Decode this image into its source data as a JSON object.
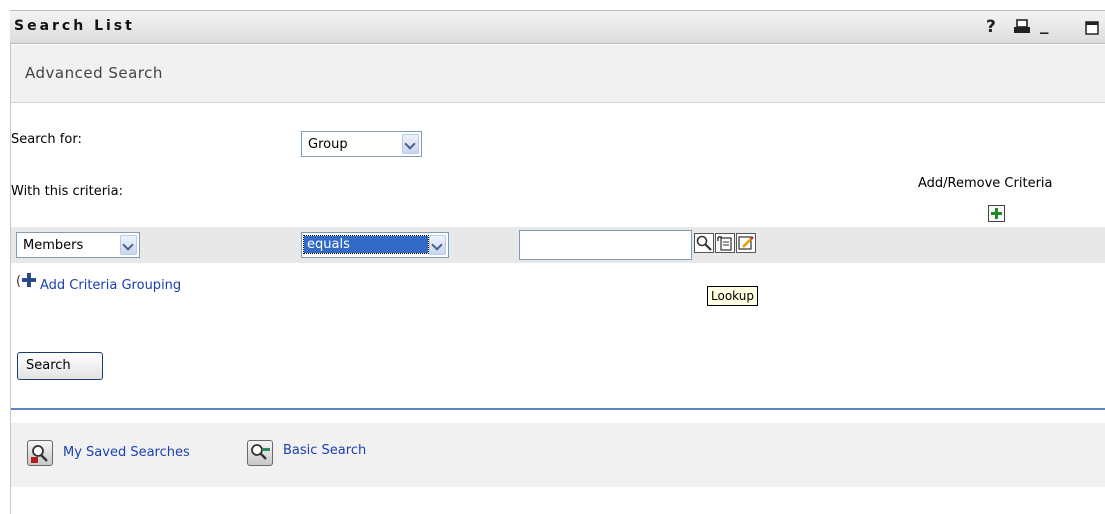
{
  "window": {
    "title": "Search List",
    "controls": {
      "help": "?",
      "print_icon": "print-icon",
      "minimize": "_",
      "maximize_icon": "maximize-icon"
    }
  },
  "header": {
    "subtitle": "Advanced Search"
  },
  "form": {
    "search_for_label": "Search for:",
    "search_for_value": "Group",
    "criteria_label": "With this criteria:",
    "add_remove_label": "Add/Remove Criteria",
    "criteria_row": {
      "attribute": "Members",
      "operator": "equals",
      "value": ""
    },
    "add_grouping_prefix": "(",
    "add_grouping_label": "Add Criteria Grouping",
    "tooltip": "Lookup",
    "search_button": "Search"
  },
  "footer": {
    "saved_searches": "My Saved Searches",
    "basic_search": "Basic Search"
  },
  "colors": {
    "accent": "#5b86c0",
    "link": "#1a3fb0",
    "selection": "#316ac5"
  }
}
